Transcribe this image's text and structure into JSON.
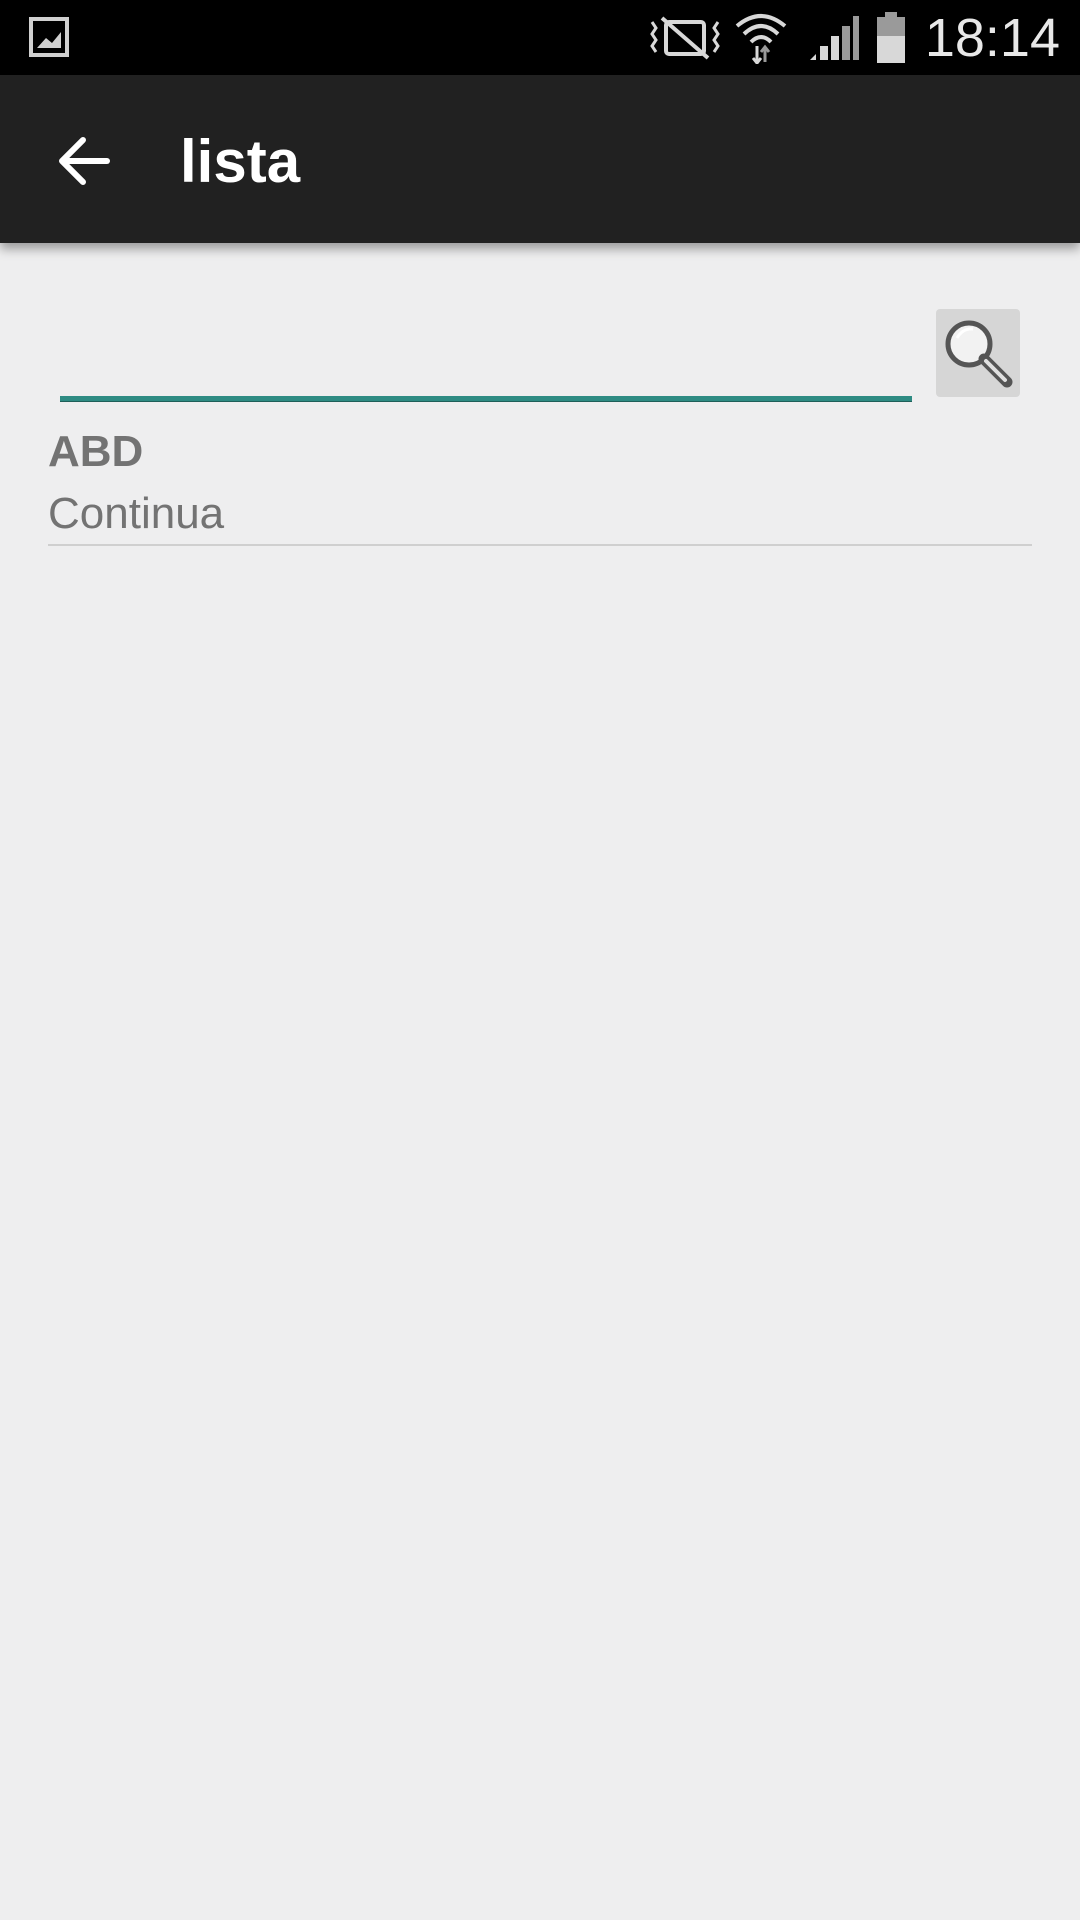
{
  "status_bar": {
    "time": "18:14",
    "icons": [
      "gallery-icon",
      "vibrate-icon",
      "wifi-icon",
      "signal-icon",
      "battery-icon"
    ]
  },
  "app_bar": {
    "title": "lista",
    "back_icon": "arrow-back-icon"
  },
  "search": {
    "value": "",
    "placeholder": "",
    "button_icon": "search-icon",
    "accent_color": "#2e8b83"
  },
  "list": {
    "items": [
      {
        "title": "ABD",
        "subtitle": "Continua"
      }
    ]
  },
  "colors": {
    "status_bar_bg": "#000000",
    "app_bar_bg": "#212121",
    "page_bg": "#eeeeef",
    "item_text": "#737373"
  }
}
